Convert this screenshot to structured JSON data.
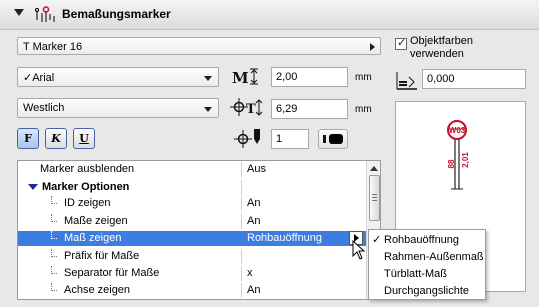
{
  "header": {
    "title": "Bemaßungsmarker",
    "expand_icon": "caret-down-icon",
    "section_icon": "dimension-marker-icon"
  },
  "marker_selector": {
    "value": "T Marker 16",
    "icon": "chevron-right-icon"
  },
  "font": {
    "value": "Arial",
    "check_glyph": "✓"
  },
  "script": {
    "value": "Westlich"
  },
  "size": {
    "value": "2,00",
    "unit": "mm",
    "icon": "text-size-icon"
  },
  "offset": {
    "value": "6,29",
    "unit": "mm",
    "icon": "text-offset-icon"
  },
  "pen": {
    "value": "1",
    "icon": "pen-icon"
  },
  "style_buttons": {
    "bold": "F",
    "italic": "K",
    "underline": "U"
  },
  "object_colors": {
    "label_line1": "Objektfarben",
    "label_line2": "verwenden",
    "checked": true
  },
  "rotation": {
    "value": "0,000",
    "icon": "angle-icon"
  },
  "preview": {
    "marker_label": "W03",
    "dim_text_1": "88",
    "dim_text_2": "2,01",
    "accent": "#c8102e"
  },
  "table": {
    "rows": [
      {
        "label": "Marker ausblenden",
        "value": "Aus",
        "type": "plain"
      },
      {
        "label": "Marker Optionen",
        "value": "",
        "type": "group"
      },
      {
        "label": "ID zeigen",
        "value": "An",
        "type": "child"
      },
      {
        "label": "Maße zeigen",
        "value": "An",
        "type": "child"
      },
      {
        "label": "Maß zeigen",
        "value": "Rohbauöffnung",
        "type": "child",
        "selected": true
      },
      {
        "label": "Präfix für Maße",
        "value": "",
        "type": "child"
      },
      {
        "label": "Separator für Maße",
        "value": "x",
        "type": "child"
      },
      {
        "label": "Achse zeigen",
        "value": "An",
        "type": "child"
      }
    ]
  },
  "dropdown": {
    "items": [
      "Rohbauöffnung",
      "Rahmen-Außenmaß",
      "Türblatt-Maß",
      "Durchgangslichte"
    ],
    "selected_index": 0,
    "check_glyph": "✓"
  },
  "colors": {
    "selection": "#3d7ce0",
    "group_caret": "#1a2a9a",
    "button_border": "#4a63a8"
  }
}
